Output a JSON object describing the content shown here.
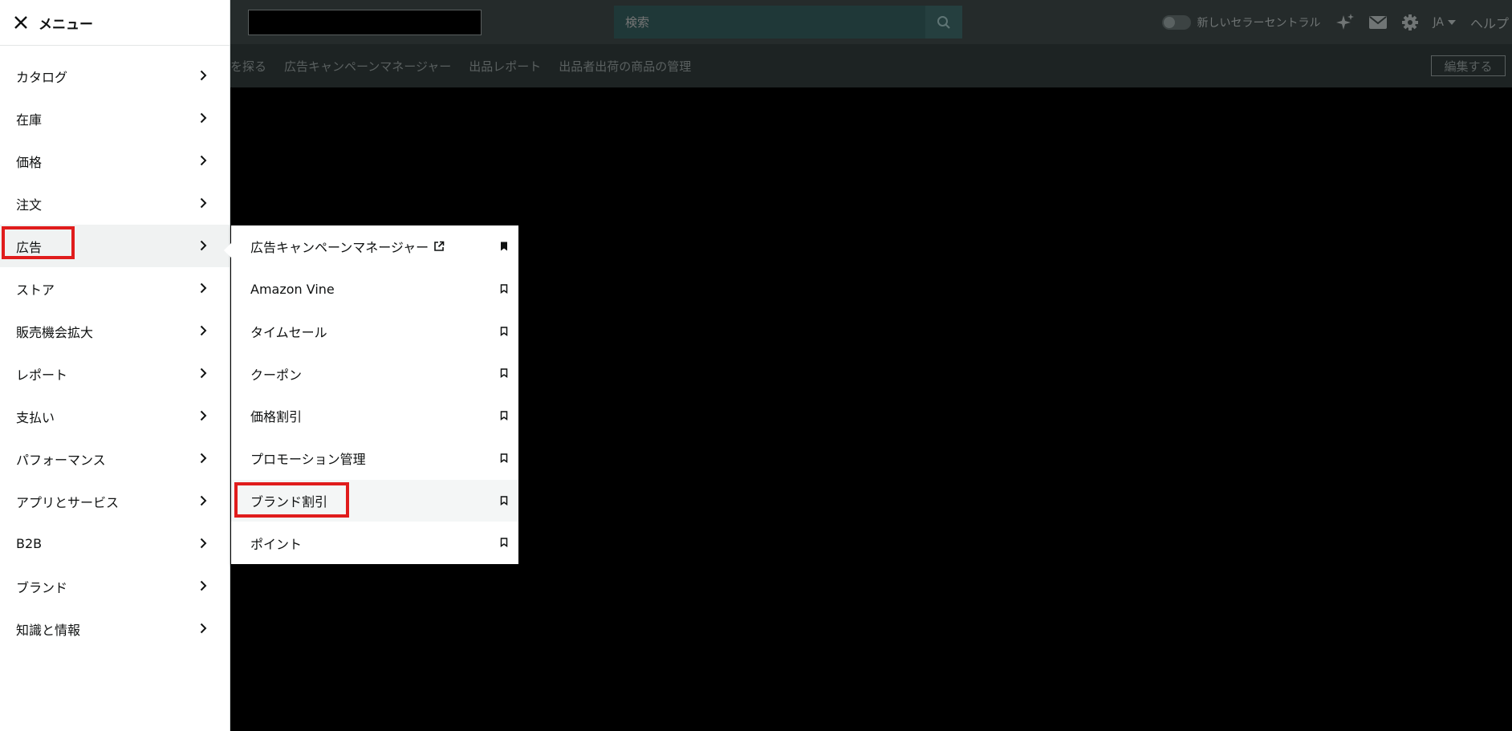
{
  "header": {
    "search_placeholder": "検索",
    "toggle_label": "新しいセラーセントラル",
    "language": "JA",
    "help": "ヘルプ"
  },
  "nav": {
    "links": [
      "を探る",
      "広告キャンペーンマネージャー",
      "出品レポート",
      "出品者出荷の商品の管理"
    ],
    "edit_label": "編集する"
  },
  "menu": {
    "title": "メニュー",
    "items": [
      {
        "label": "カタログ"
      },
      {
        "label": "在庫"
      },
      {
        "label": "価格"
      },
      {
        "label": "注文"
      },
      {
        "label": "広告",
        "active": true
      },
      {
        "label": "ストア"
      },
      {
        "label": "販売機会拡大"
      },
      {
        "label": "レポート"
      },
      {
        "label": "支払い"
      },
      {
        "label": "パフォーマンス"
      },
      {
        "label": "アプリとサービス"
      },
      {
        "label": "B2B"
      },
      {
        "label": "ブランド"
      },
      {
        "label": "知識と情報"
      }
    ]
  },
  "submenu": {
    "items": [
      {
        "label": "広告キャンペーンマネージャー",
        "external": true,
        "bookmarked": true
      },
      {
        "label": "Amazon Vine",
        "bookmarked": false
      },
      {
        "label": "タイムセール",
        "bookmarked": false
      },
      {
        "label": "クーポン",
        "bookmarked": false
      },
      {
        "label": "価格割引",
        "bookmarked": false
      },
      {
        "label": "プロモーション管理",
        "bookmarked": false
      },
      {
        "label": "ブランド割引",
        "bookmarked": false,
        "active": true
      },
      {
        "label": "ポイント",
        "bookmarked": false
      }
    ]
  },
  "colors": {
    "highlight": "#e01c1c",
    "topbar": "#252b2b",
    "navbar": "#1d2323"
  }
}
